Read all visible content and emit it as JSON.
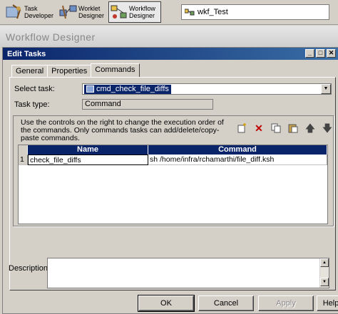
{
  "toolbar": {
    "task_developer": "Task\nDeveloper",
    "worklet_designer": "Worklet\nDesigner",
    "workflow_designer": "Workflow\nDesigner",
    "workflow_name": "wkf_Test"
  },
  "designer_title": "Workflow Designer",
  "dialog": {
    "title": "Edit Tasks",
    "tabs": [
      "General",
      "Properties",
      "Commands"
    ],
    "select_task_label": "Select task:",
    "select_task_value": "cmd_check_file_diffs",
    "task_type_label": "Task type:",
    "task_type_value": "Command",
    "info_text": "Use the controls on the right to change the execution order of the commands.  Only commands tasks can add/delete/copy-paste commands.",
    "grid": {
      "headers": [
        "Name",
        "Command"
      ],
      "rows": [
        {
          "num": "1",
          "name": "check_file_diffs",
          "command": "sh /home/infra/rchamarthi/file_diff.ksh"
        }
      ]
    },
    "description_label": "Description:",
    "buttons": {
      "ok": "OK",
      "cancel": "Cancel",
      "apply": "Apply",
      "help": "Help"
    }
  }
}
